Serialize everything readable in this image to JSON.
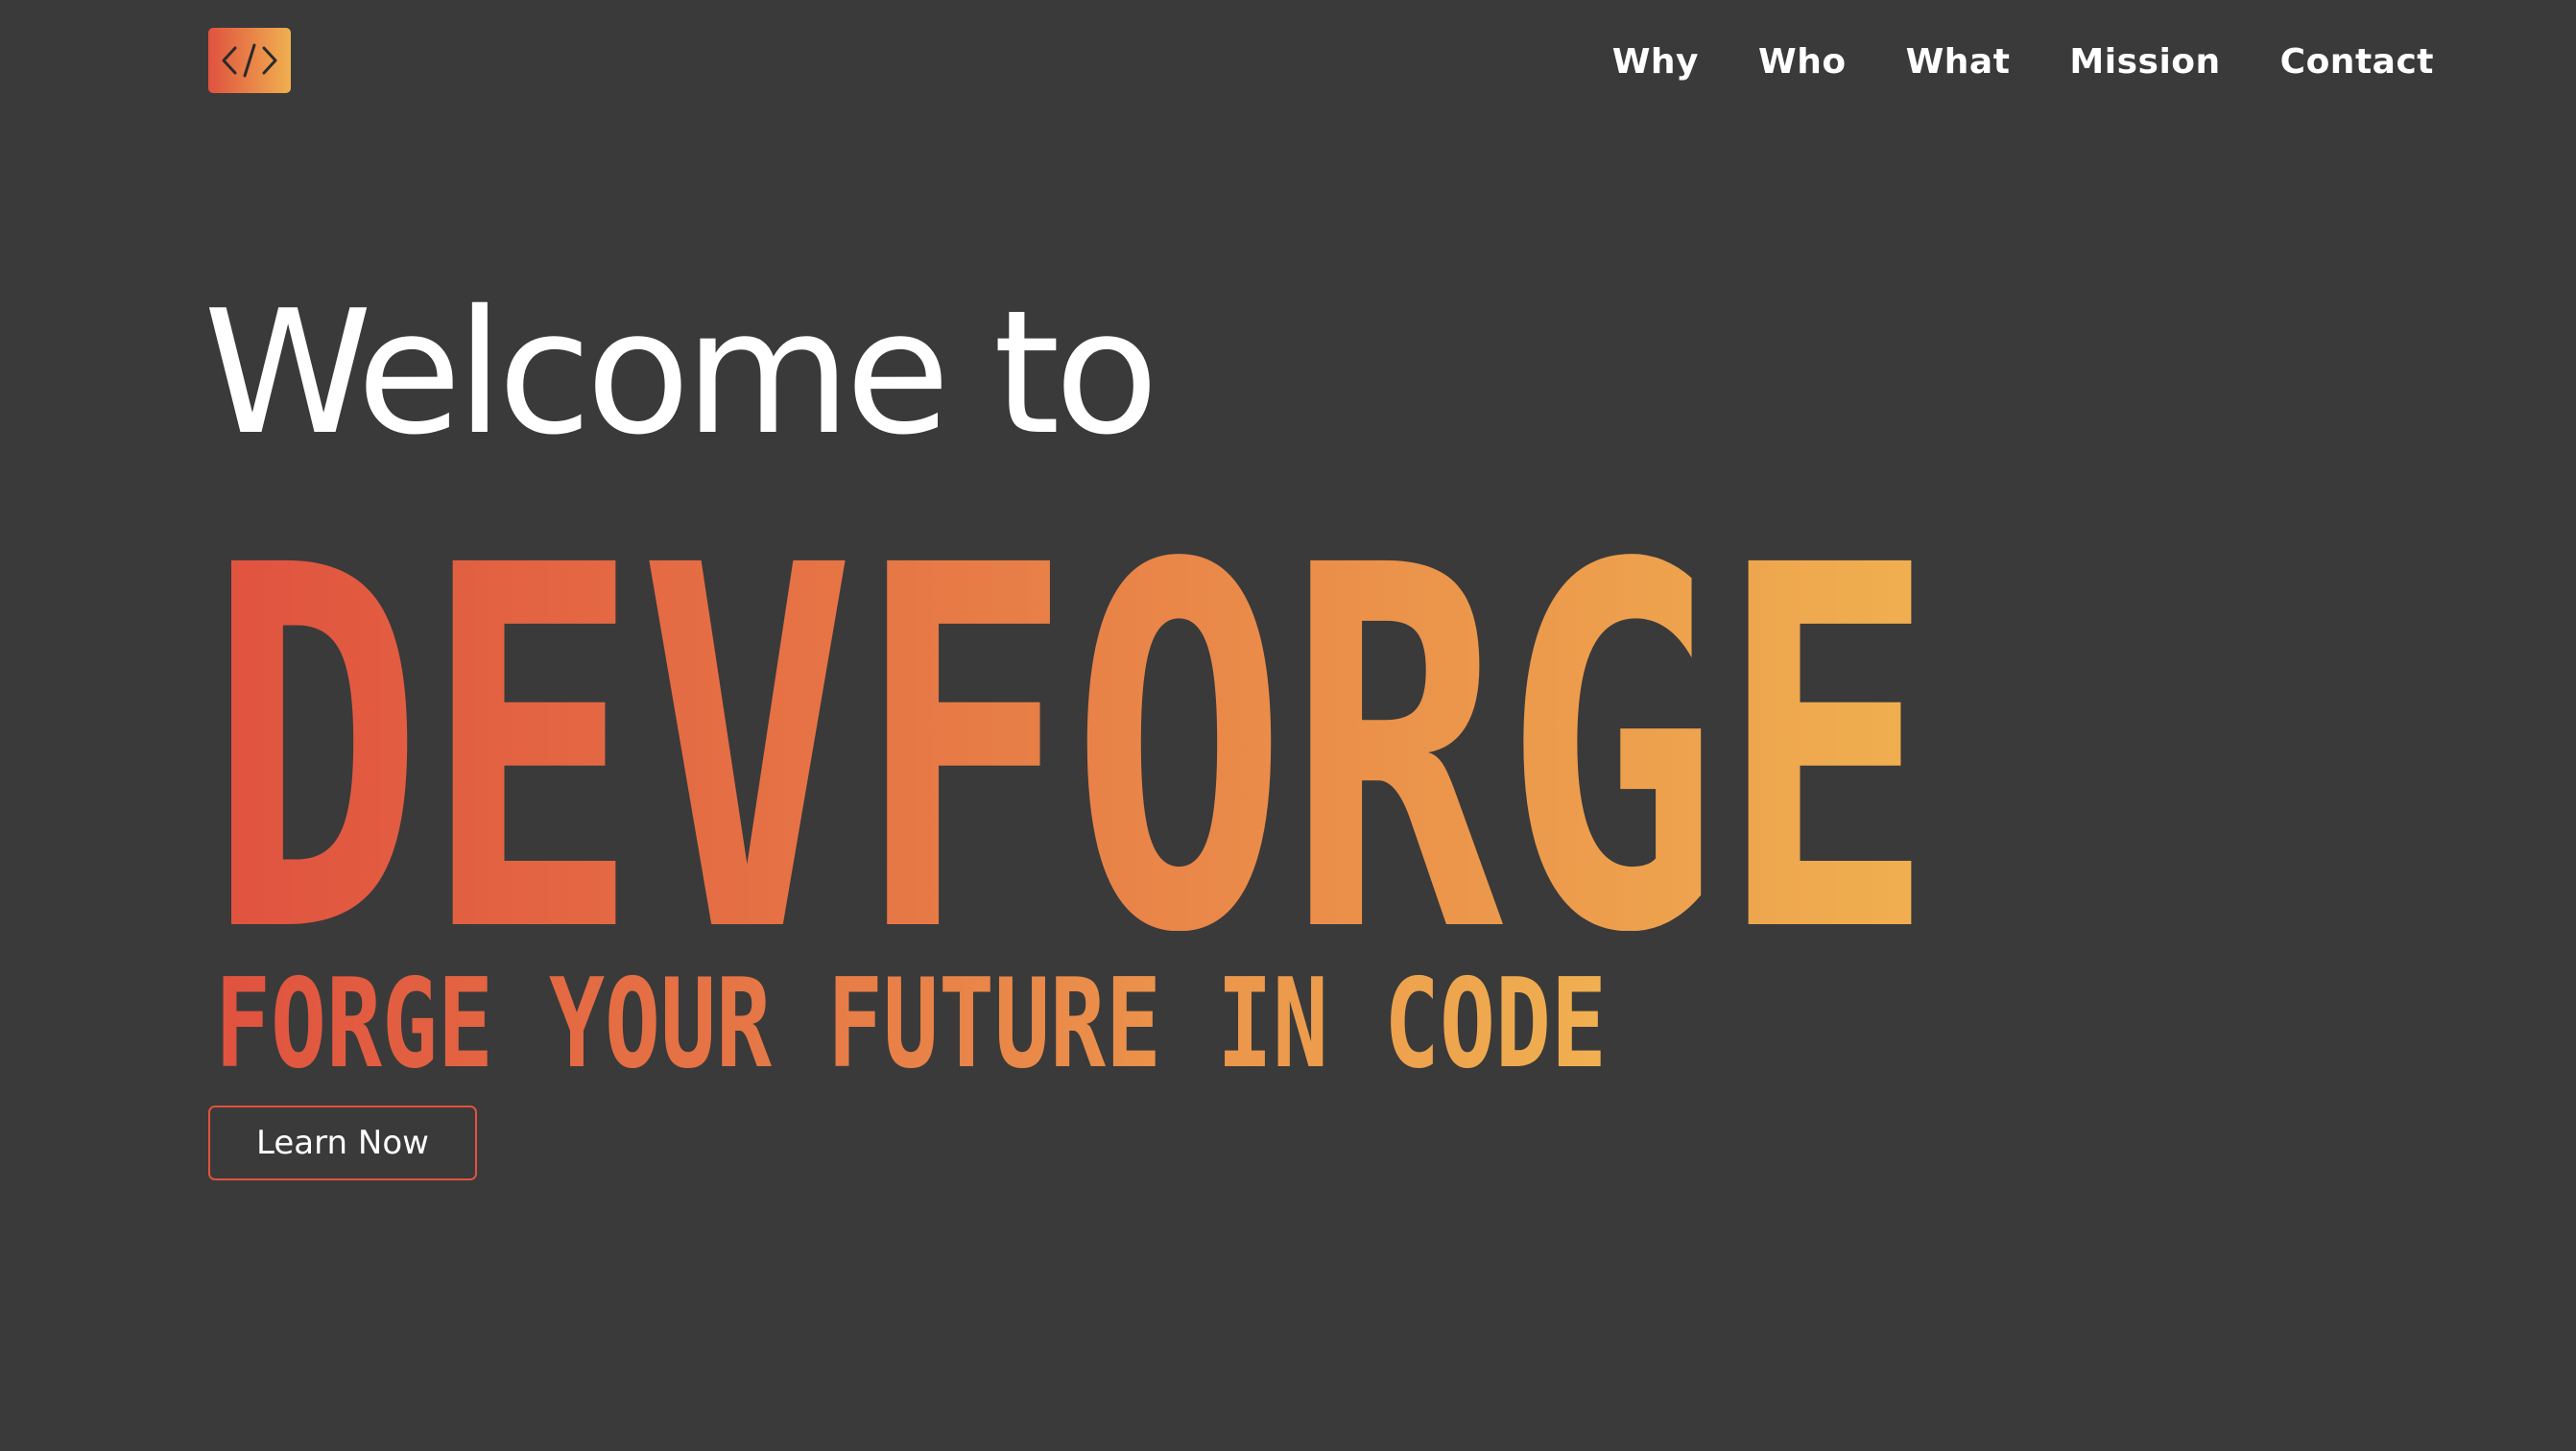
{
  "logo": {
    "glyph": "</>",
    "icon": "code-brackets-icon",
    "gradient_start": "#e0523f",
    "gradient_end": "#f0b050"
  },
  "nav": {
    "items": [
      {
        "label": "Why"
      },
      {
        "label": "Who"
      },
      {
        "label": "What"
      },
      {
        "label": "Mission"
      },
      {
        "label": "Contact"
      }
    ]
  },
  "hero": {
    "welcome": "Welcome to",
    "brand": "DEVFORGE",
    "tagline": "FORGE YOUR FUTURE IN CODE",
    "cta_label": "Learn Now"
  },
  "colors": {
    "background": "#3a3a3a",
    "accent_start": "#e0523f",
    "accent_end": "#f0b050",
    "text": "#ffffff"
  }
}
